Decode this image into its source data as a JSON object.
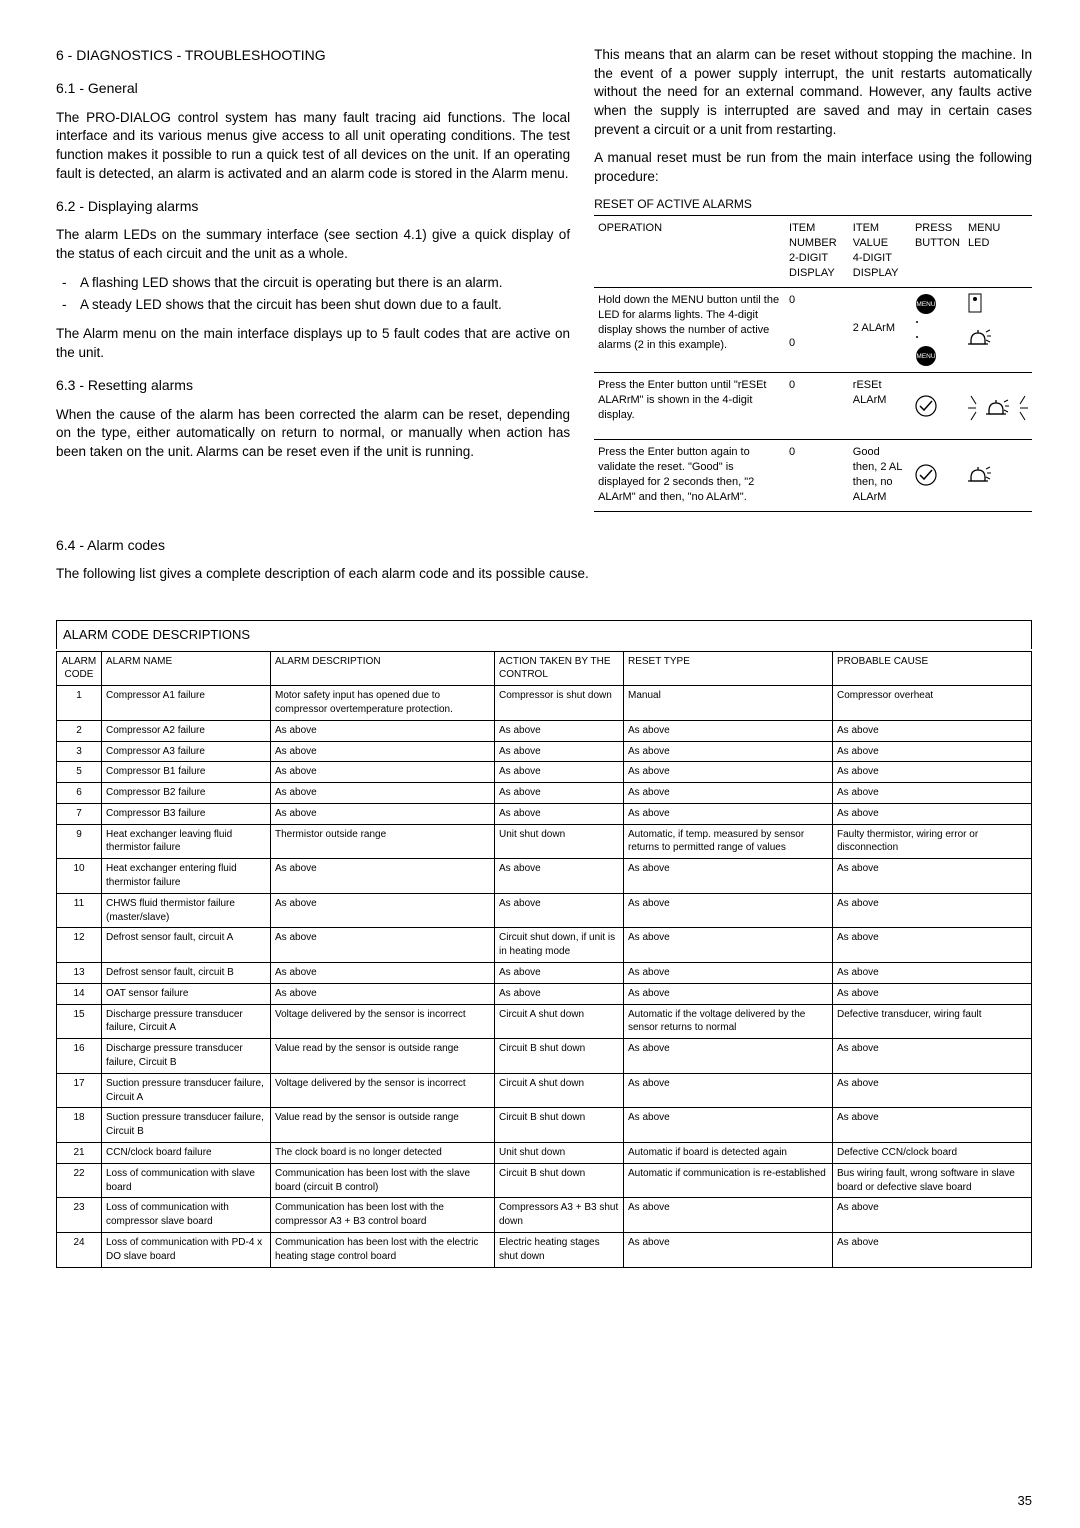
{
  "sec6": {
    "title": "6 - DIAGNOSTICS - TROUBLESHOOTING",
    "s61": {
      "title": "6.1 - General",
      "p1": "The PRO-DIALOG control system has many fault tracing aid functions. The local interface and its various menus give access to all unit operating conditions. The test function makes it possible to run a quick test of all devices on the unit. If an operating fault is detected, an alarm is activated and an alarm code is stored in the Alarm menu."
    },
    "s62": {
      "title": "6.2 - Displaying alarms",
      "p1": "The alarm LEDs on the summary interface (see section 4.1) give a quick display of the status of each circuit and the unit as a whole.",
      "li1": "A flashing LED shows that the circuit is operating but there is an alarm.",
      "li2": "A steady LED shows that the circuit has been shut down due to a fault.",
      "p2": "The Alarm menu on the main interface displays up to 5 fault codes that are active on the unit."
    },
    "s63": {
      "title": "6.3 - Resetting alarms",
      "p1": "When the cause of the alarm has been corrected the alarm can be reset, depending on the type, either automatically on return to normal, or manually when action has been taken on the unit. Alarms can be reset even if the unit is running.",
      "p2": "This means that an alarm can be reset without stopping the machine. In the event of a power supply interrupt, the unit restarts automatically without the need for an external command. However, any faults active when the supply is interrupted are saved and may in certain cases prevent a circuit or a unit from restarting.",
      "p3": "A manual reset must be run from the main interface using the following procedure:"
    },
    "s64": {
      "title": "6.4 -  Alarm codes",
      "p1": "The following list gives a complete description of each alarm code and its possible cause."
    }
  },
  "resetTable": {
    "title": "RESET OF ACTIVE ALARMS",
    "h1": "OPERATION",
    "h2a": "ITEM NUMBER",
    "h2b": "2-DIGIT DISPLAY",
    "h3a": "ITEM VALUE",
    "h3b": "4-DIGIT DISPLAY",
    "h4a": "PRESS",
    "h4b": "BUTTON",
    "h5a": "MENU",
    "h5b": "LED",
    "r1": {
      "op": "Hold down the MENU button until the LED for alarms lights. The 4-digit display shows the number of active alarms (2 in this example).",
      "n1": "0",
      "n2": "0",
      "v1": "",
      "v2": "2 ALArM"
    },
    "r2": {
      "op": "Press the Enter button until \"rESEt ALARrM\" is shown in the 4-digit display.",
      "n": "0",
      "v": "rESEt ALArM"
    },
    "r3": {
      "op": "Press the Enter button again to validate the reset. \"Good\" is displayed for 2 seconds then, \"2 ALArM\" and then, \"no ALArM\".",
      "n": "0",
      "v": "Good\nthen, 2 AL\nthen, no ALArM"
    }
  },
  "alarmTable": {
    "title": "ALARM CODE DESCRIPTIONS",
    "headers": {
      "code": "ALARM CODE",
      "name": "ALARM NAME",
      "desc": "ALARM DESCRIPTION",
      "action": "ACTION TAKEN BY THE CONTROL",
      "reset": "RESET TYPE",
      "cause": "PROBABLE CAUSE"
    },
    "rows": [
      {
        "c": "1",
        "n": "Compressor A1 failure",
        "d": "Motor safety input has opened due to compressor overtemperature protection.",
        "a": "Compressor is shut down",
        "r": "Manual",
        "p": "Compressor overheat"
      },
      {
        "c": "2",
        "n": "Compressor A2 failure",
        "d": "As above",
        "a": "As above",
        "r": "As above",
        "p": "As above"
      },
      {
        "c": "3",
        "n": "Compressor A3 failure",
        "d": "As above",
        "a": "As above",
        "r": "As above",
        "p": "As above"
      },
      {
        "c": "5",
        "n": "Compressor B1 failure",
        "d": "As above",
        "a": "As above",
        "r": "As above",
        "p": "As above"
      },
      {
        "c": "6",
        "n": "Compressor B2 failure",
        "d": "As above",
        "a": "As above",
        "r": "As above",
        "p": "As above"
      },
      {
        "c": "7",
        "n": "Compressor B3 failure",
        "d": "As above",
        "a": "As above",
        "r": "As above",
        "p": "As above"
      },
      {
        "c": "9",
        "n": "Heat exchanger leaving fluid thermistor failure",
        "d": "Thermistor outside range",
        "a": "Unit shut down",
        "r": "Automatic, if  temp. measured by sensor returns to permitted range of values",
        "p": "Faulty thermistor, wiring error or disconnection"
      },
      {
        "c": "10",
        "n": "Heat exchanger entering fluid thermistor failure",
        "d": "As above",
        "a": "As above",
        "r": "As above",
        "p": "As above"
      },
      {
        "c": "11",
        "n": "CHWS fluid thermistor failure (master/slave)",
        "d": "As above",
        "a": "As above",
        "r": "As above",
        "p": "As above"
      },
      {
        "c": "12",
        "n": "Defrost sensor fault, circuit A",
        "d": "As above",
        "a": "Circuit shut down, if unit is in heating mode",
        "r": "As above",
        "p": "As above"
      },
      {
        "c": "13",
        "n": "Defrost sensor fault, circuit B",
        "d": "As above",
        "a": "As above",
        "r": "As above",
        "p": "As above"
      },
      {
        "c": "14",
        "n": "OAT sensor failure",
        "d": "As above",
        "a": "As above",
        "r": "As above",
        "p": "As above"
      },
      {
        "c": "15",
        "n": "Discharge pressure transducer failure, Circuit A",
        "d": "Voltage delivered by the sensor is incorrect",
        "a": "Circuit A shut down",
        "r": "Automatic if the voltage delivered by the sensor returns to normal",
        "p": "Defective transducer, wiring fault"
      },
      {
        "c": "16",
        "n": "Discharge pressure transducer failure, Circuit B",
        "d": "Value read by the sensor is outside range",
        "a": "Circuit B shut down",
        "r": "As above",
        "p": "As above"
      },
      {
        "c": "17",
        "n": "Suction pressure transducer failure, Circuit A",
        "d": "Voltage delivered by the sensor is incorrect",
        "a": "Circuit A shut down",
        "r": "As above",
        "p": "As above"
      },
      {
        "c": "18",
        "n": "Suction pressure transducer failure, Circuit B",
        "d": "Value read by the sensor is outside range",
        "a": "Circuit B shut down",
        "r": "As above",
        "p": "As above"
      },
      {
        "c": "21",
        "n": "CCN/clock board failure",
        "d": "The clock board is no longer detected",
        "a": "Unit shut down",
        "r": "Automatic if board is detected again",
        "p": "Defective CCN/clock board"
      },
      {
        "c": "22",
        "n": "Loss of communication with slave board",
        "d": "Communication has been lost with the slave board (circuit B control)",
        "a": "Circuit B shut down",
        "r": "Automatic if communication is re-established",
        "p": "Bus wiring fault, wrong software in slave board or defective slave board"
      },
      {
        "c": "23",
        "n": "Loss of communication with compressor slave board",
        "d": "Communication has been lost with the compressor A3 + B3 control board",
        "a": "Compressors A3 + B3 shut down",
        "r": "As above",
        "p": "As above"
      },
      {
        "c": "24",
        "n": "Loss of communication with PD-4 x DO slave board",
        "d": "Communication has been lost with the electric heating stage control board",
        "a": "Electric heating stages shut down",
        "r": "As above",
        "p": "As above"
      }
    ]
  },
  "pageNum": "35"
}
